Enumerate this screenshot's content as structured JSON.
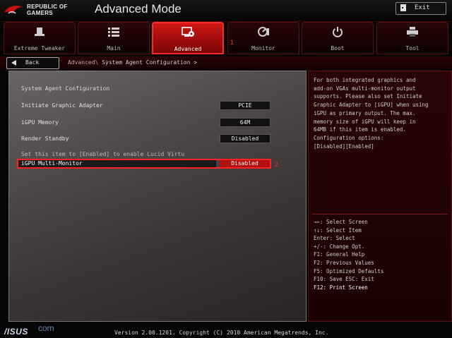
{
  "header": {
    "brand_line1": "REPUBLIC OF",
    "brand_line2": "GAMERS",
    "mode_title": "Advanced Mode",
    "exit_label": "Exit"
  },
  "tabs": [
    {
      "label": "Extreme Tweaker",
      "icon": "hat-icon"
    },
    {
      "label": "Main",
      "icon": "list-icon"
    },
    {
      "label": "Advanced",
      "icon": "advanced-icon",
      "active": true
    },
    {
      "label": "Monitor",
      "icon": "gauge-icon"
    },
    {
      "label": "Boot",
      "icon": "power-icon"
    },
    {
      "label": "Tool",
      "icon": "printer-icon"
    }
  ],
  "annotations": {
    "mark1": "1",
    "mark2": "2"
  },
  "breadcrumb": {
    "back_label": "Back",
    "parent": "Advanced\\",
    "current": "System Agent Configuration >"
  },
  "settings": {
    "section_title": "System Agent Configuration",
    "rows": [
      {
        "label": "Initiate Graphic Adapter",
        "value": "PCIE"
      },
      {
        "label": "iGPU Memory",
        "value": "64M"
      },
      {
        "label": "Render Standby",
        "value": "Disabled"
      }
    ],
    "hint": "Set this item to [Enabled] to enable Lucid Virtu",
    "selected": {
      "label": "iGPU Multi-Monitor",
      "value": "Disabled"
    }
  },
  "help": {
    "lines": [
      "For both integrated graphics and",
      "add-on VGAs multi-monitor output",
      "supports. Please also set Initiate",
      "Graphic Adapter to [iGPU] when using",
      "iGPU as primary output. The max.",
      "memory size of iGPU will keep in",
      "64MB if this item is enabled.",
      "Configuration options:",
      "[Disabled][Enabled]"
    ]
  },
  "keys": [
    "→←: Select Screen",
    "↑↓: Select Item",
    "Enter: Select",
    "+/-: Change Opt.",
    "F1: General Help",
    "F2: Previous Values",
    "F5: Optimized Defaults",
    "F10: Save  ESC: Exit",
    "F12: Print Screen"
  ],
  "footer": {
    "version": "Version 2.00.1201. Copyright (C) 2010 American Megatrends, Inc.",
    "asus": "/ISUS",
    "watermark": "com"
  },
  "colors": {
    "accent": "#d01818",
    "highlight_border": "#ff2222"
  }
}
